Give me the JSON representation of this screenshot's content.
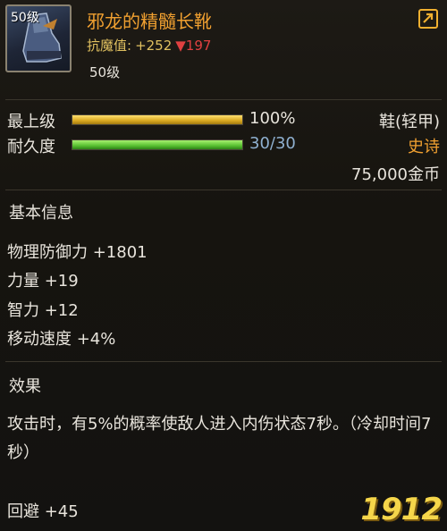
{
  "header": {
    "icon_level": "50级",
    "item_name": "邪龙的精髓长靴",
    "stat_label": "抗魔值:",
    "stat_plus": "+252",
    "stat_down": "▼197",
    "level_req": "50级",
    "share_icon": "share-export-icon"
  },
  "bars": {
    "top_level": {
      "label": "最上级",
      "value_text": "100%",
      "fraction": 1.0
    },
    "durability": {
      "label": "耐久度",
      "value_text": "30/30",
      "fraction": 1.0
    }
  },
  "meta": {
    "type": "鞋(轻甲)",
    "rarity": "史诗",
    "price": "75,000金币"
  },
  "basic_info": {
    "title": "基本信息",
    "attributes": [
      "物理防御力 +1801",
      "力量 +19",
      "智力 +12",
      "移动速度 +4%"
    ]
  },
  "effect": {
    "title": "效果",
    "text": "攻击时，有5%的概率使敌人进入内伤状态7秒。（冷却时间7秒）",
    "dodge": "回避 +45"
  },
  "watermark": "1912",
  "colors": {
    "rarity": "#f0a030",
    "durability_text": "#8fb0d0",
    "negative": "#e04040"
  }
}
